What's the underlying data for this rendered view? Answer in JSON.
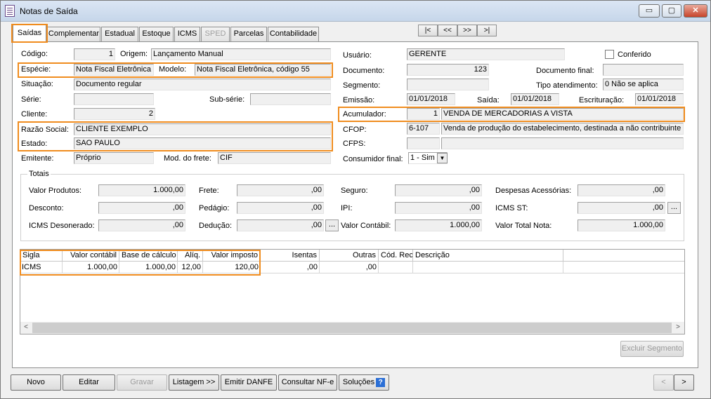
{
  "window": {
    "title": "Notas de Saída",
    "min": "▭",
    "max": "▢",
    "close": "✕"
  },
  "tabs": [
    "Saídas",
    "Complementar",
    "Estadual",
    "Estoque",
    "ICMS",
    "SPED",
    "Parcelas",
    "Contabilidade"
  ],
  "nav": [
    "|<",
    "<<",
    ">>",
    ">|"
  ],
  "left": {
    "codigo_label": "Código:",
    "codigo": "1",
    "origem_label": "Origem:",
    "origem": "Lançamento Manual",
    "especie_label": "Espécie:",
    "especie": "Nota Fiscal Eletrônica",
    "modelo_label": "Modelo:",
    "modelo": "Nota Fiscal Eletrônica, código 55",
    "situacao_label": "Situação:",
    "situacao": "Documento regular",
    "serie_label": "Série:",
    "serie": "",
    "subserie_label": "Sub-série:",
    "subserie": "",
    "cliente_label": "Cliente:",
    "cliente": "2",
    "razao_label": "Razão Social:",
    "razao": "CLIENTE EXEMPLO",
    "estado_label": "Estado:",
    "estado": "SAO PAULO",
    "emitente_label": "Emitente:",
    "emitente": "Próprio",
    "frete_label": "Mod. do frete:",
    "frete": "CIF"
  },
  "right": {
    "usuario_label": "Usuário:",
    "usuario": "GERENTE",
    "conferido_label": "Conferido",
    "documento_label": "Documento:",
    "documento": "123",
    "docfinal_label": "Documento final:",
    "docfinal": "",
    "segmento_label": "Segmento:",
    "segmento": "",
    "tipoatend_label": "Tipo atendimento:",
    "tipoatend": "0 Não se aplica",
    "emissao_label": "Emissão:",
    "emissao": "01/01/2018",
    "saida_label": "Saída:",
    "saida": "01/01/2018",
    "escrit_label": "Escrituração:",
    "escrit": "01/01/2018",
    "acum_label": "Acumulador:",
    "acum_code": "1",
    "acum": "VENDA DE MERCADORIAS A VISTA",
    "cfop_label": "CFOP:",
    "cfop_code": "6-107",
    "cfop": "Venda de produção do estabelecimento, destinada a não contribuinte",
    "cfps_label": "CFPS:",
    "cfps_code": "",
    "cfps": "",
    "consfinal_label": "Consumidor final:",
    "consfinal": "1 - Sim"
  },
  "totais": {
    "title": "Totais",
    "valor_produtos_label": "Valor Produtos:",
    "valor_produtos": "1.000,00",
    "frete_label": "Frete:",
    "frete": ",00",
    "seguro_label": "Seguro:",
    "seguro": ",00",
    "desp_label": "Despesas Acessórias:",
    "desp": ",00",
    "desconto_label": "Desconto:",
    "desconto": ",00",
    "pedagio_label": "Pedágio:",
    "pedagio": ",00",
    "ipi_label": "IPI:",
    "ipi": ",00",
    "icmsst_label": "ICMS ST:",
    "icmsst": ",00",
    "icmsdes_label": "ICMS Desonerado:",
    "icmsdes": ",00",
    "deducao_label": "Dedução:",
    "deducao": ",00",
    "contabil_label": "Valor Contábil:",
    "contabil": "1.000,00",
    "totalnota_label": "Valor Total Nota:",
    "totalnota": "1.000,00"
  },
  "grid": {
    "headers": [
      "Sigla",
      "Valor contábil",
      "Base de cálculo",
      "Alíq.",
      "Valor imposto",
      "Isentas",
      "Outras",
      "Cód. Rec.",
      "Descrição"
    ],
    "row": [
      "ICMS",
      "1.000,00",
      "1.000,00",
      "12,00",
      "120,00",
      ",00",
      ",00",
      "",
      ""
    ]
  },
  "excluir_segmento": "Excluir Segmento",
  "buttons": [
    "Novo",
    "Editar",
    "Gravar",
    "Listagem >>",
    "Emitir DANFE",
    "Consultar NF-e",
    "Soluções"
  ],
  "pager": [
    "<",
    ">"
  ],
  "ellipsis": "..."
}
